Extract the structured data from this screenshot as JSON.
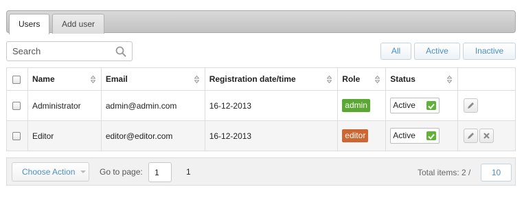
{
  "tabs": [
    {
      "label": "Users",
      "active": true
    },
    {
      "label": "Add user",
      "active": false
    }
  ],
  "search": {
    "placeholder": "Search",
    "value": ""
  },
  "filters": [
    "All",
    "Active",
    "Inactive"
  ],
  "table": {
    "columns": [
      "Name",
      "Email",
      "Registration date/time",
      "Role",
      "Status"
    ],
    "rows": [
      {
        "name": "Administrator",
        "email": "admin@admin.com",
        "registered": "16-12-2013",
        "role": "admin",
        "role_color": "#5aa832",
        "status": "Active"
      },
      {
        "name": "Editor",
        "email": "editor@editor.com",
        "registered": "16-12-2013",
        "role": "editor",
        "role_color": "#cc6633",
        "status": "Active"
      }
    ]
  },
  "footer": {
    "choose_action": "Choose Action",
    "goto_label": "Go to page:",
    "page_value": "1",
    "page_total": "1",
    "total_label": "Total items: 2 /",
    "per_page": "10"
  },
  "colors": {
    "accent": "#4a8fc7",
    "status_check": "#5fb336"
  },
  "icons": [
    "search-icon",
    "sort-icon",
    "check-icon",
    "edit-icon",
    "delete-icon",
    "caret-down-icon"
  ]
}
